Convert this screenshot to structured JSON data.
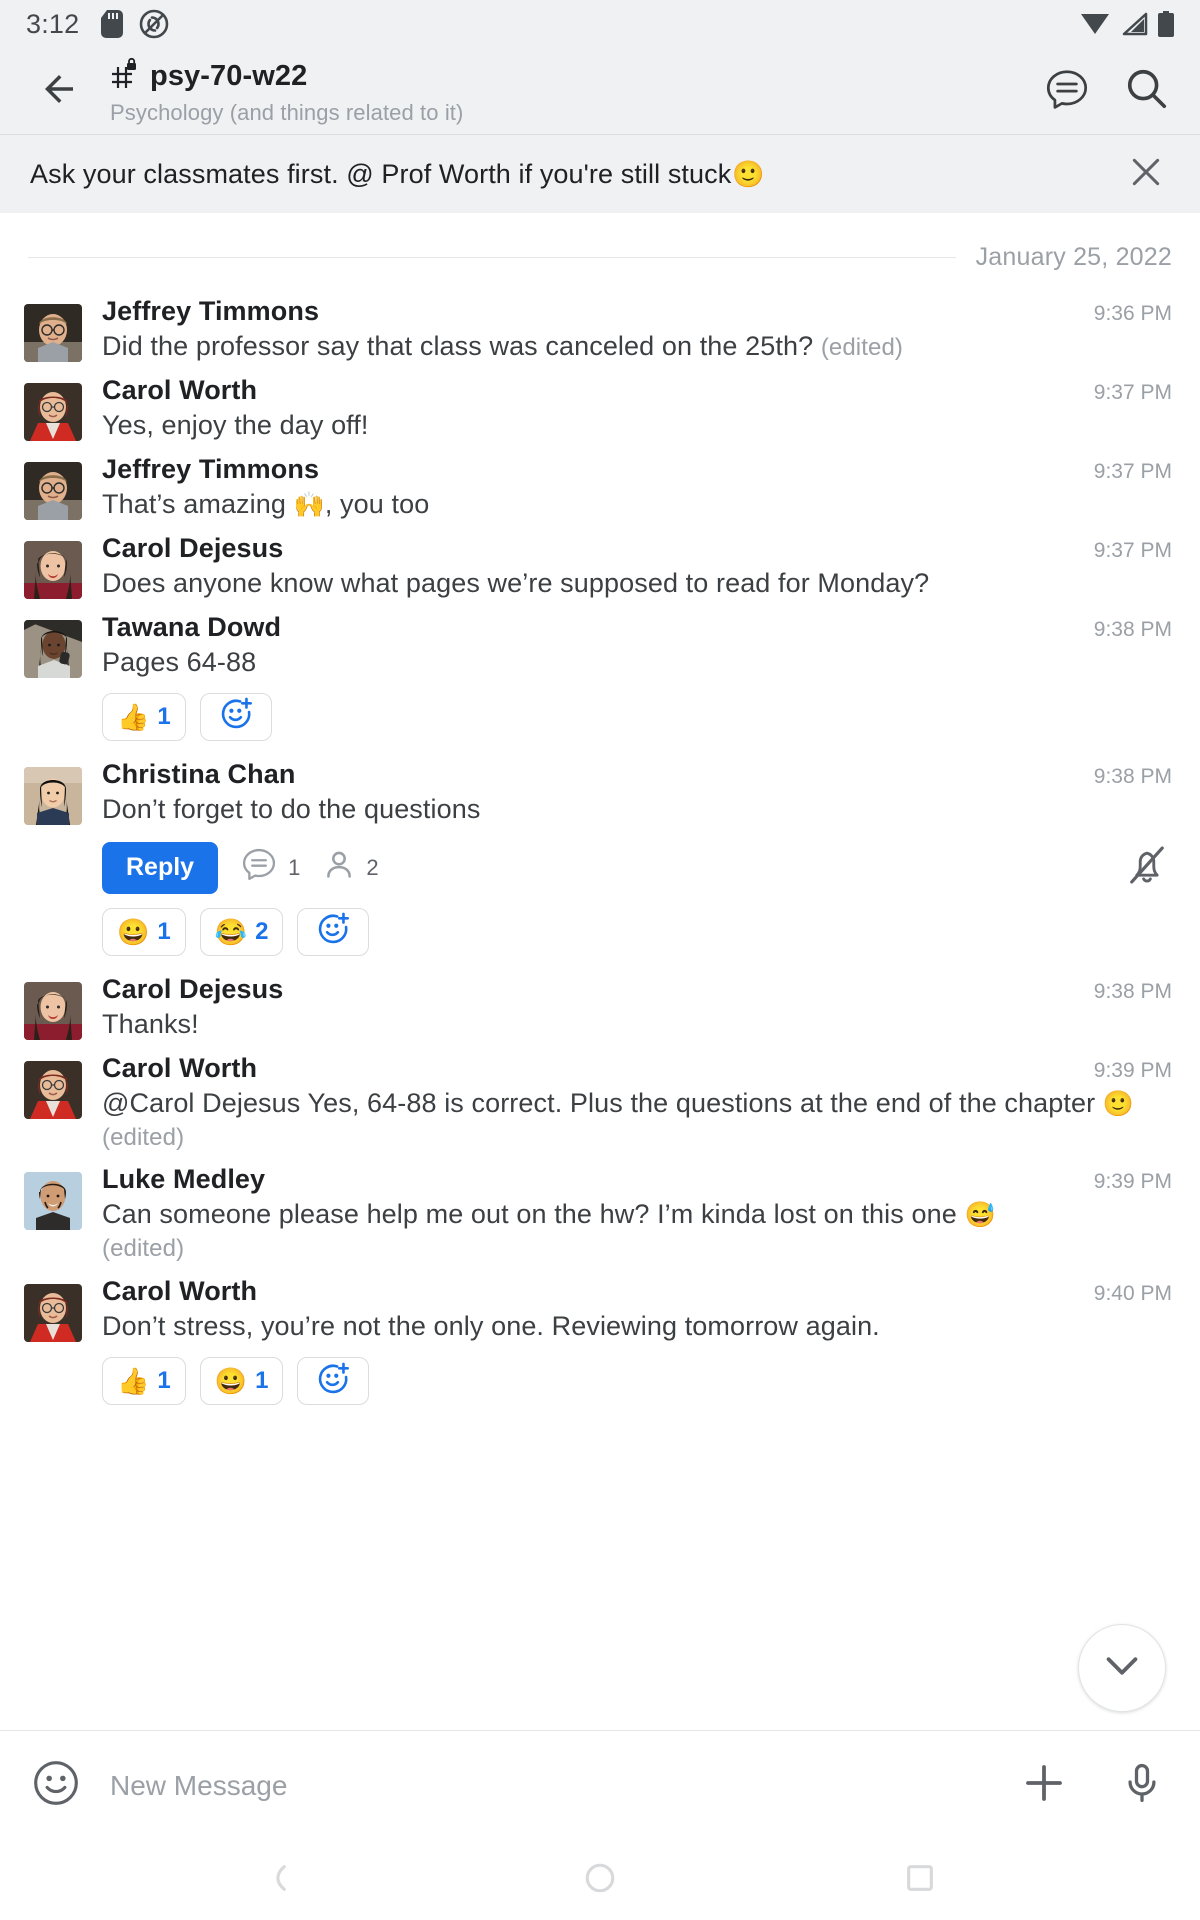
{
  "status_bar": {
    "time": "3:12",
    "icons": [
      "sd-card-icon",
      "ringer-off-icon",
      "wifi-icon",
      "cell-signal-icon",
      "battery-icon"
    ]
  },
  "app_bar": {
    "back": "back-arrow-icon",
    "room_name": "psy-70-w22",
    "room_subtitle": "Psychology (and things related to it)",
    "hash_lock_icon": "private-channel-icon",
    "chat_summary_icon": "chat-summary-icon",
    "search_icon": "search-icon"
  },
  "banner": {
    "text": "Ask your classmates first. @ Prof Worth if you're still stuck",
    "emoji": "🙂",
    "close_icon": "close-icon"
  },
  "date_divider": {
    "label": "January 25, 2022"
  },
  "colors": {
    "accent": "#1a73e8",
    "app_bar_bg": "#eff1f3",
    "text_primary": "#202124",
    "text_secondary": "#9aa0a6"
  },
  "messages": [
    {
      "author": "Jeffrey Timmons",
      "time": "9:36 PM",
      "text": "Did the professor say that class was canceled on the 25th?",
      "edited": "(edited)",
      "avatar": "jeffrey-timmons-avatar"
    },
    {
      "author": "Carol Worth",
      "time": "9:37 PM",
      "text": "Yes, enjoy the day off!",
      "edited": "",
      "avatar": "carol-worth-avatar"
    },
    {
      "author": "Jeffrey Timmons",
      "time": "9:37 PM",
      "text_before": "That’s amazing ",
      "emoji": "🙌",
      "text_after": ", you too",
      "edited": "",
      "avatar": "jeffrey-timmons-avatar"
    },
    {
      "author": "Carol Dejesus",
      "time": "9:37 PM",
      "text": "Does anyone know what pages we’re supposed to read for Monday?",
      "edited": "",
      "avatar": "carol-dejesus-avatar"
    },
    {
      "author": "Tawana Dowd",
      "time": "9:38 PM",
      "text": "Pages 64-88",
      "edited": "",
      "avatar": "tawana-dowd-avatar",
      "reactions": [
        {
          "emoji": "👍",
          "count": "1"
        }
      ],
      "add_reaction_icon": "add-reaction-icon"
    },
    {
      "author": "Christina Chan",
      "time": "9:38 PM",
      "text": "Don’t forget to do the questions",
      "edited": "",
      "avatar": "christina-chan-avatar",
      "reply_label": "Reply",
      "thread_count": "1",
      "participant_count": "2",
      "mute_icon": "bell-off-icon",
      "reactions": [
        {
          "emoji": "😀",
          "count": "1"
        },
        {
          "emoji": "😂",
          "count": "2"
        }
      ],
      "add_reaction_icon": "add-reaction-icon"
    },
    {
      "author": "Carol Dejesus",
      "time": "9:38 PM",
      "text": "Thanks!",
      "edited": "",
      "avatar": "carol-dejesus-avatar"
    },
    {
      "author": "Carol Worth",
      "time": "9:39 PM",
      "text_before": "@Carol Dejesus Yes, 64-88 is correct. Plus the questions at the end of the chapter ",
      "emoji": "🙂",
      "text_after": " ",
      "edited": "(edited)",
      "avatar": "carol-worth-avatar"
    },
    {
      "author": "Luke Medley",
      "time": "9:39 PM",
      "text_before": "Can someone please help me out on the hw? I’m kinda lost on this one ",
      "emoji": "😅",
      "text_after": "",
      "edited": "(edited)",
      "avatar": "luke-medley-avatar"
    },
    {
      "author": "Carol Worth",
      "time": "9:40 PM",
      "text": "Don’t stress, you’re not the only one. Reviewing tomorrow again.",
      "edited": "",
      "avatar": "carol-worth-avatar",
      "reactions": [
        {
          "emoji": "👍",
          "count": "1"
        },
        {
          "emoji": "😀",
          "count": "1"
        }
      ],
      "add_reaction_icon": "add-reaction-icon"
    }
  ],
  "scroll_fab": {
    "icon": "chevron-down-icon"
  },
  "compose": {
    "emoji_icon": "emoji-icon",
    "placeholder": "New Message",
    "value": "",
    "plus_icon": "plus-icon",
    "mic_icon": "microphone-icon"
  },
  "nav_bar": {
    "back_icon": "nav-back-icon",
    "home_icon": "nav-home-icon",
    "recents_icon": "nav-recents-icon"
  }
}
